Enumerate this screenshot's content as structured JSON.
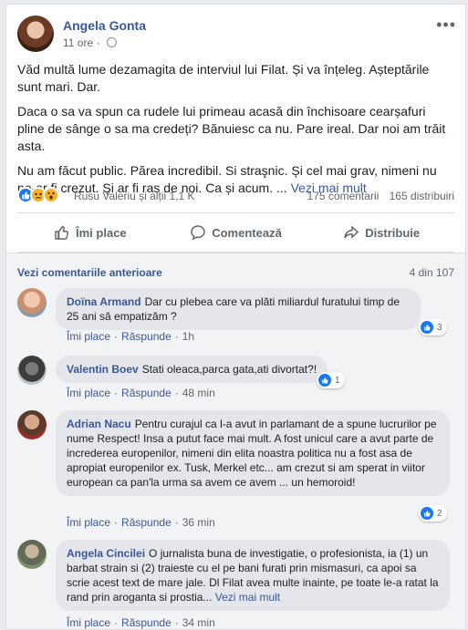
{
  "post": {
    "author": "Angela Gonta",
    "time": "11 ore",
    "more_icon": "•••",
    "paragraphs": [
      "Văd multă lume dezamagita de interviul lui Filat. Și va înțeleg. Așteptările sunt mari. Dar.",
      "Daca o sa va spun ca rudele lui primeau acasă din închisoare cearșafuri pline de sânge o sa ma credeți? Bănuiesc ca nu. Pare ireal. Dar noi am trăit asta.",
      "Nu am făcut public. Părea incredibil. Si straşnic. Și cel mai grav, nimeni nu ne-ar fi crezut. Și ar fi ras de noi. Ca și acum. ..."
    ],
    "see_more": "Vezi mai mult",
    "reactions_text": "Rusu Valeriu și alții 1,1 K",
    "comments_count": "175 comentarii",
    "shares_count": "165 distribuiri",
    "reaction_icons": [
      "like-icon",
      "sad-icon",
      "wow-icon"
    ]
  },
  "actions": {
    "like": "Îmi place",
    "comment": "Comentează",
    "share": "Distribuie"
  },
  "comments_section": {
    "prev_link": "Vezi comentariile anterioare",
    "page_count": "4 din 107",
    "like_label": "Îmi place",
    "reply_label": "Răspunde",
    "items": [
      {
        "name": "Doïna Armand",
        "text": "Dar cu plebea care va plăti miliardul furatului timp de 25 ani să empatizăm ?",
        "time": "1h",
        "likes": "3"
      },
      {
        "name": "Valentin Boev",
        "text": "Stati oleaca,parca gata,ati divortat?!",
        "time": "48 min",
        "likes": "1"
      },
      {
        "name": "Adrian Nacu",
        "text": "Pentru curajul ca l-a avut in parlamant de a spune lucrurilor pe nume Respect! Insa a putut face mai mult. A fost unicul care a avut parte de increderea europenilor, nimeni din elita noastra politica nu a fost asa de apropiat europenilor ex. Tusk, Merkel etc... am crezut si am sperat in viitor european ca pan'la urma sa avem ce avem ... un hemoroid!",
        "time": "36 min",
        "likes": "2"
      },
      {
        "name": "Angela Cincilei",
        "text": "O jurnalista buna de investigatie, o profesionista, ia (1) un barbat strain si (2) traieste cu el pe bani furati prin mismasuri, ca apoi sa scrie acest text de mare jale. Dl Filat avea multe inainte, pe toate le-a ratat la rand prin aroganta si prostia...",
        "see_more": "Vezi mai mult",
        "time": "34 min",
        "likes": ""
      }
    ]
  },
  "colors": {
    "link": "#385898",
    "accent": "#1877f2",
    "bubble": "#e4e6eb",
    "background": "#e9ebee"
  }
}
